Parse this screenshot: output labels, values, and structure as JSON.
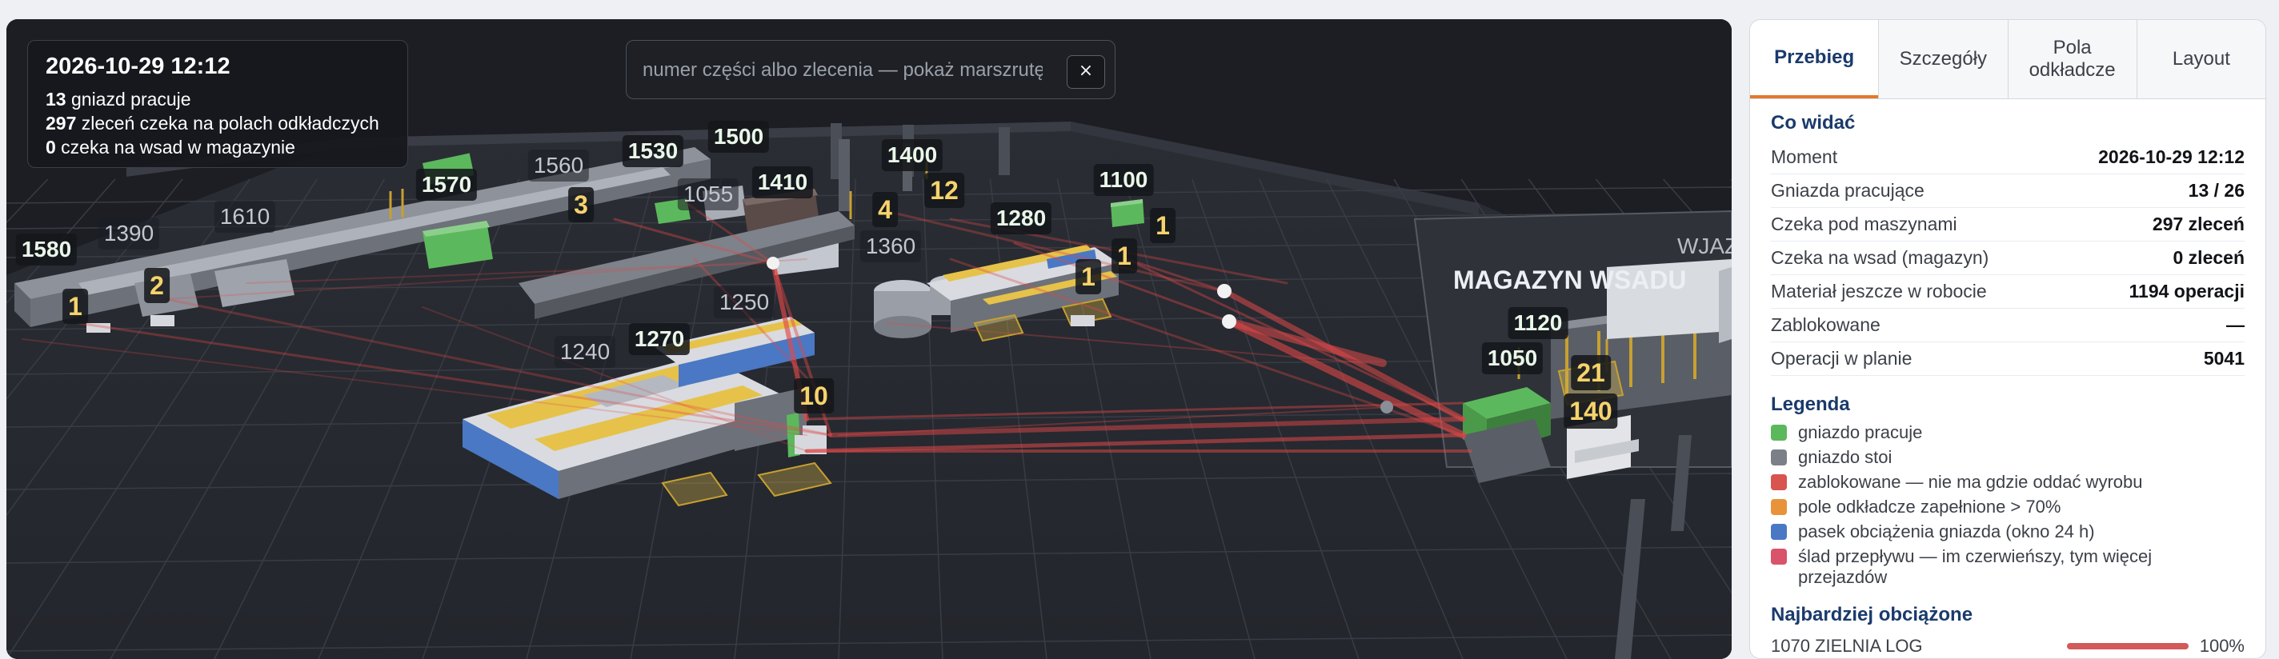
{
  "overlay": {
    "timestamp": "2026-10-29 12:12",
    "stats": [
      {
        "value": "13",
        "text": " gniazd pracuje"
      },
      {
        "value": "297",
        "text": " zleceń czeka na polach odkładczych"
      },
      {
        "value": "0",
        "text": " czeka na wsad w magazynie"
      }
    ]
  },
  "search": {
    "placeholder": "numer części albo zlecenia — pokaż marszrutę",
    "clear_label": "×"
  },
  "scene": {
    "station_labels": [
      {
        "text": "1580",
        "style": "g"
      },
      {
        "text": "1390",
        "style": "d"
      },
      {
        "text": "1610",
        "style": "d"
      },
      {
        "text": "1560",
        "style": "d"
      },
      {
        "text": "1570",
        "style": "g"
      },
      {
        "text": "1530",
        "style": "g"
      },
      {
        "text": "1500",
        "style": "g"
      },
      {
        "text": "1055",
        "style": "d"
      },
      {
        "text": "1410",
        "style": "g"
      },
      {
        "text": "1400",
        "style": "g"
      },
      {
        "text": "1100",
        "style": "g"
      },
      {
        "text": "1280",
        "style": "g"
      },
      {
        "text": "1360",
        "style": "d"
      },
      {
        "text": "1250",
        "style": "d"
      },
      {
        "text": "1240",
        "style": "d"
      },
      {
        "text": "1270",
        "style": "g"
      },
      {
        "text": "1120",
        "style": "g"
      },
      {
        "text": "1050",
        "style": "g"
      }
    ],
    "queue_counts": [
      {
        "text": "1"
      },
      {
        "text": "2"
      },
      {
        "text": "3"
      },
      {
        "text": "4"
      },
      {
        "text": "12"
      },
      {
        "text": "1"
      },
      {
        "text": "1"
      },
      {
        "text": "1"
      },
      {
        "text": "10"
      },
      {
        "text": "21"
      },
      {
        "text": "140"
      }
    ],
    "warehouse_label": "MAGAZYN WSADU",
    "entry_label": "WJAZD"
  },
  "tabs": [
    {
      "label": "Przebieg",
      "active": true
    },
    {
      "label": "Szczegóły",
      "active": false
    },
    {
      "label": "Pola odkładcze",
      "active": false
    },
    {
      "label": "Layout",
      "active": false
    }
  ],
  "summary": {
    "title": "Co widać",
    "rows": [
      {
        "label": "Moment",
        "value": "2026-10-29 12:12"
      },
      {
        "label": "Gniazda pracujące",
        "value": "13 / 26"
      },
      {
        "label": "Czeka pod maszynami",
        "value": "297 zleceń"
      },
      {
        "label": "Czeka na wsad (magazyn)",
        "value": "0 zleceń"
      },
      {
        "label": "Materiał jeszcze w robocie",
        "value": "1194 operacji"
      },
      {
        "label": "Zablokowane",
        "value": "—"
      },
      {
        "label": "Operacji w planie",
        "value": "5041"
      }
    ]
  },
  "legend": {
    "title": "Legenda",
    "items": [
      {
        "color": "#5cb85c",
        "label": "gniazdo pracuje"
      },
      {
        "color": "#7b8088",
        "label": "gniazdo stoi"
      },
      {
        "color": "#d9534f",
        "label": "zablokowane — nie ma gdzie oddać wyrobu"
      },
      {
        "color": "#e8933a",
        "label": "pole odkładcze zapełnione > 70%"
      },
      {
        "color": "#4a78c4",
        "label": "pasek obciążenia gniazda (okno 24 h)"
      },
      {
        "color": "#d9536a",
        "label": "ślad przepływu — im czerwieńszy, tym więcej przejazdów"
      }
    ]
  },
  "busiest": {
    "title": "Najbardziej obciążone",
    "rows": [
      {
        "name": "1070 ZIELNIA LOG",
        "value": "100%",
        "load": 1.0
      }
    ]
  }
}
